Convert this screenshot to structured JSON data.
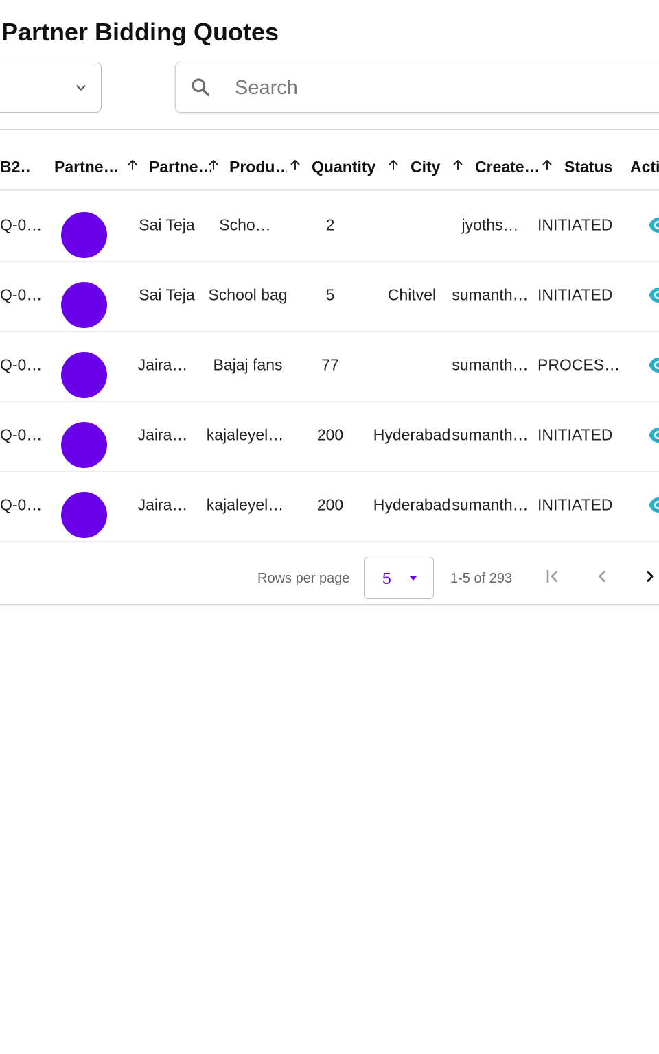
{
  "page": {
    "title": "Partner Bidding Quotes"
  },
  "filter": {
    "value": ""
  },
  "search": {
    "placeholder": "Search",
    "value": ""
  },
  "colors": {
    "accent": "#6200ea",
    "avatar": "#6a00ea",
    "eye": "#2ab0c8",
    "pagination_text": "#666666"
  },
  "table": {
    "columns": [
      {
        "key": "b2",
        "label": "B2…",
        "sortable": false
      },
      {
        "key": "partner_avatar",
        "label": "Partne…",
        "sortable": true
      },
      {
        "key": "partner_name",
        "label": "Partne…",
        "sortable": true
      },
      {
        "key": "product",
        "label": "Produ…",
        "sortable": true
      },
      {
        "key": "quantity",
        "label": "Quantity",
        "sortable": true
      },
      {
        "key": "city",
        "label": "City",
        "sortable": true
      },
      {
        "key": "created_by",
        "label": "Create…",
        "sortable": true
      },
      {
        "key": "status",
        "label": "Status",
        "sortable": false
      },
      {
        "key": "actions",
        "label": "Acti",
        "sortable": false
      }
    ],
    "rows": [
      {
        "b2": "Q-0…",
        "partner_name": "Sai Teja",
        "product": "Scho…",
        "quantity": "2",
        "city": "",
        "created_by": "jyoths…",
        "status": "INITIATED",
        "action_icon": "eye-icon"
      },
      {
        "b2": "Q-0…",
        "partner_name": "Sai Teja",
        "product": "School bag",
        "quantity": "5",
        "city": "Chitvel",
        "created_by": "sumanth…",
        "status": "INITIATED",
        "action_icon": "eye-icon"
      },
      {
        "b2": "Q-0…",
        "partner_name": "Jaira…",
        "product": "Bajaj fans",
        "quantity": "77",
        "city": "",
        "created_by": "sumanth…",
        "status": "PROCES…",
        "action_icon": "eye-icon"
      },
      {
        "b2": "Q-0…",
        "partner_name": "Jaira…",
        "product": "kajaleyel…",
        "quantity": "200",
        "city": "Hyderabad",
        "created_by": "sumanth…",
        "status": "INITIATED",
        "action_icon": "eye-icon"
      },
      {
        "b2": "Q-0…",
        "partner_name": "Jaira…",
        "product": "kajaleyel…",
        "quantity": "200",
        "city": "Hyderabad",
        "created_by": "sumanth…",
        "status": "INITIATED",
        "action_icon": "eye-icon"
      }
    ]
  },
  "pagination": {
    "rows_per_page_label": "Rows per page",
    "rows_per_page": "5",
    "range": "1-5 of 293"
  }
}
